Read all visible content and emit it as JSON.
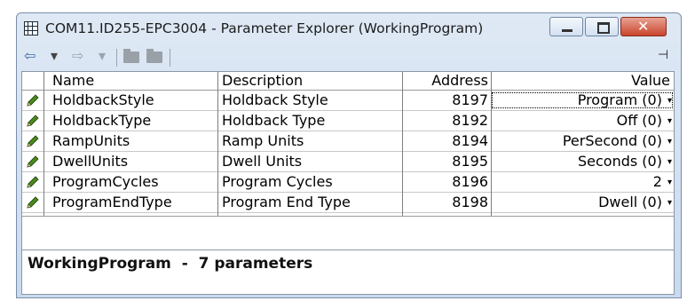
{
  "window": {
    "title": "COM11.ID255-EPC3004 - Parameter Explorer (WorkingProgram)"
  },
  "toolbar": {
    "icons": [
      "back-arrow-icon",
      "dropdown-icon",
      "forward-arrow-icon",
      "dropdown-icon",
      "folder-icon",
      "folder-icon",
      "pin-icon"
    ],
    "back_glyph": "⇦",
    "forward_glyph": "⇨",
    "dropdown_glyph": "▾",
    "pin_glyph": "⊣"
  },
  "table": {
    "columns": [
      "Name",
      "Description",
      "Address",
      "Value"
    ],
    "rows": [
      {
        "name": "HoldbackStyle",
        "description": "Holdback Style",
        "address": "8197",
        "value": "Program (0)"
      },
      {
        "name": "HoldbackType",
        "description": "Holdback Type",
        "address": "8192",
        "value": "Off (0)"
      },
      {
        "name": "RampUnits",
        "description": "Ramp Units",
        "address": "8194",
        "value": "PerSecond (0)"
      },
      {
        "name": "DwellUnits",
        "description": "Dwell Units",
        "address": "8195",
        "value": "Seconds (0)"
      },
      {
        "name": "ProgramCycles",
        "description": "Program Cycles",
        "address": "8196",
        "value": "2"
      },
      {
        "name": "ProgramEndType",
        "description": "Program End Type",
        "address": "8198",
        "value": "Dwell (0)"
      }
    ]
  },
  "status": {
    "text": "WorkingProgram  -  7 parameters"
  },
  "colors": {
    "pencil": "#4a8a1e",
    "title_bar": "#d4e2f2",
    "close_button": "#c9452c"
  }
}
